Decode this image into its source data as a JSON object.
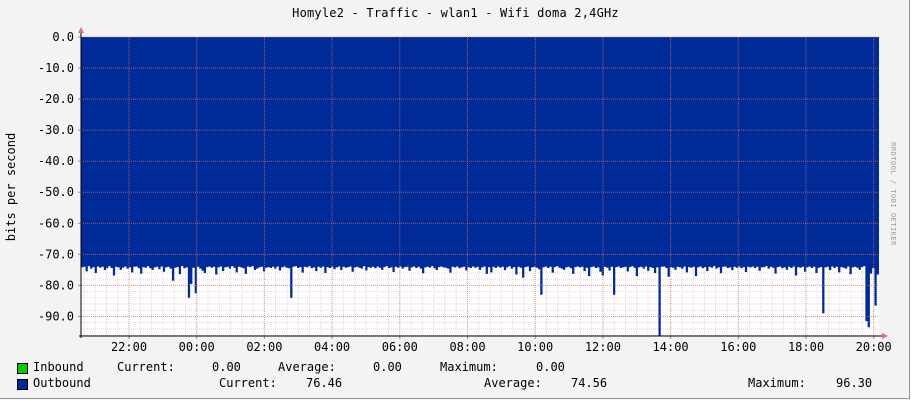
{
  "title": "Homyle2 - Traffic - wlan1 - Wifi doma 2,4GHz",
  "watermark": "RRDTOOL / TOBI OETIKER",
  "colors": {
    "background": "#F3F3F3",
    "plot_background": "#FFFFFF",
    "inbound": "#00CC00",
    "outbound": "#002A97",
    "grid": "#E0B0B0"
  },
  "legend": {
    "inbound": {
      "name": "Inbound",
      "current_label": "Current:",
      "current_value": "0.00",
      "average_label": "Average:",
      "average_value": "0.00",
      "maximum_label": "Maximum:",
      "maximum_value": "0.00"
    },
    "outbound": {
      "name": "Outbound",
      "current_label": "Current:",
      "current_value": "76.46",
      "average_label": "Average:",
      "average_value": "74.56",
      "maximum_label": "Maximum:",
      "maximum_value": "96.30"
    }
  },
  "chart_data": {
    "type": "area",
    "title": "Homyle2 - Traffic - wlan1 - Wifi doma 2,4GHz",
    "ylabel": "bits per second",
    "ylim": [
      -96.3,
      0
    ],
    "yticks": [
      "0.0",
      "-10.0",
      "-20.0",
      "-30.0",
      "-40.0",
      "-50.0",
      "-60.0",
      "-70.0",
      "-80.0",
      "-90.0"
    ],
    "ytick_values": [
      0,
      -10,
      -20,
      -30,
      -40,
      -50,
      -60,
      -70,
      -80,
      -90
    ],
    "xticks": [
      "22:00",
      "00:00",
      "02:00",
      "04:00",
      "06:00",
      "08:00",
      "10:00",
      "12:00",
      "14:00",
      "16:00",
      "18:00",
      "20:00"
    ],
    "grid": true,
    "series": [
      {
        "name": "Inbound",
        "values_summary": {
          "current": 0.0,
          "average": 0.0,
          "maximum": 0.0
        },
        "values": []
      },
      {
        "name": "Outbound",
        "values_summary": {
          "current": 76.46,
          "average": 74.56,
          "maximum": 96.3
        },
        "values": [
          -74.2,
          -74.0,
          -75.5,
          -73.8,
          -74.6,
          -74.1,
          -76.0,
          -73.9,
          -74.3,
          -74.0,
          -75.1,
          -74.5,
          -73.8,
          -74.4,
          -76.8,
          -74.0,
          -74.2,
          -75.0,
          -74.3,
          -73.9,
          -74.6,
          -74.2,
          -75.8,
          -74.0,
          -73.9,
          -74.5,
          -76.2,
          -74.1,
          -74.3,
          -73.8,
          -74.5,
          -75.0,
          -74.2,
          -74.0,
          -74.8,
          -73.9,
          -75.6,
          -74.2,
          -74.0,
          -74.6,
          -78.5,
          -74.3,
          -74.1,
          -76.4,
          -73.8,
          -74.5,
          -74.2,
          -84.0,
          -79.5,
          -74.3,
          -82.5,
          -74.0,
          -74.6,
          -75.3,
          -76.0,
          -74.1,
          -73.9,
          -74.3,
          -74.0,
          -76.5,
          -74.2,
          -73.9,
          -75.4,
          -74.2,
          -74.0,
          -74.6,
          -73.8,
          -74.3,
          -75.8,
          -74.0,
          -74.2,
          -74.5,
          -76.3,
          -73.9,
          -74.1,
          -73.8,
          -75.0,
          -74.6,
          -74.2,
          -74.0,
          -75.5,
          -74.3,
          -74.1,
          -74.4,
          -74.0,
          -74.6,
          -73.9,
          -75.2,
          -74.2,
          -73.9,
          -74.3,
          -74.5,
          -84.0,
          -74.0,
          -73.8,
          -74.4,
          -74.1,
          -75.9,
          -74.0,
          -74.2,
          -73.8,
          -74.5,
          -74.2,
          -75.4,
          -74.0,
          -74.3,
          -73.9,
          -76.0,
          -74.1,
          -74.4,
          -74.0,
          -74.8,
          -74.2,
          -73.9,
          -75.1,
          -74.0,
          -74.3,
          -74.1,
          -73.9,
          -75.6,
          -74.2,
          -74.0,
          -74.3,
          -74.6,
          -73.8,
          -75.2,
          -74.1,
          -74.3,
          -74.0,
          -74.5,
          -73.9,
          -74.3,
          -75.0,
          -74.1,
          -73.8,
          -74.4,
          -74.2,
          -75.7,
          -74.0,
          -74.3,
          -73.9,
          -74.6,
          -74.1,
          -74.0,
          -75.3,
          -74.2,
          -73.9,
          -74.4,
          -74.0,
          -74.6,
          -76.1,
          -74.2,
          -74.0,
          -74.3,
          -73.8,
          -74.5,
          -75.1,
          -74.1,
          -73.9,
          -74.2,
          -74.3,
          -74.6,
          -75.9,
          -74.0,
          -74.2,
          -73.9,
          -74.5,
          -74.2,
          -74.0,
          -75.2,
          -74.1,
          -74.4,
          -73.9,
          -74.3,
          -74.0,
          -75.0,
          -74.2,
          -73.9,
          -76.3,
          -74.1,
          -75.8,
          -74.0,
          -74.4,
          -73.9,
          -74.3,
          -74.0,
          -75.1,
          -74.2,
          -73.8,
          -74.6,
          -74.1,
          -76.5,
          -74.0,
          -74.3,
          -77.5,
          -74.1,
          -73.9,
          -75.4,
          -74.2,
          -74.0,
          -74.3,
          -74.8,
          -83.0,
          -74.2,
          -73.9,
          -74.4,
          -74.0,
          -75.9,
          -74.1,
          -73.8,
          -74.3,
          -74.6,
          -75.0,
          -74.2,
          -74.0,
          -74.5,
          -76.3,
          -74.1,
          -73.9,
          -74.2,
          -74.0,
          -75.4,
          -74.3,
          -77.0,
          -74.1,
          -73.9,
          -74.4,
          -74.2,
          -75.6,
          -76.8,
          -74.0,
          -74.3,
          -75.2,
          -74.0,
          -83.0,
          -74.1,
          -73.9,
          -74.4,
          -74.2,
          -74.0,
          -75.5,
          -74.1,
          -73.8,
          -74.3,
          -77.0,
          -74.2,
          -74.0,
          -74.6,
          -73.9,
          -75.3,
          -74.1,
          -74.4,
          -76.0,
          -74.2,
          -96.3,
          -74.0,
          -73.9,
          -74.4,
          -77.2,
          -74.1,
          -74.3,
          -75.0,
          -74.0,
          -74.2,
          -74.6,
          -73.9,
          -75.8,
          -74.1,
          -74.3,
          -74.0,
          -77.0,
          -74.2,
          -73.9,
          -74.5,
          -74.1,
          -75.4,
          -74.0,
          -74.3,
          -73.8,
          -74.6,
          -74.2,
          -76.1,
          -74.0,
          -73.9,
          -74.4,
          -74.2,
          -75.1,
          -74.0,
          -74.3,
          -73.9,
          -74.5,
          -74.1,
          -75.7,
          -74.0,
          -74.2,
          -73.9,
          -74.4,
          -74.0,
          -75.3,
          -74.2,
          -74.1,
          -73.8,
          -74.6,
          -74.0,
          -74.3,
          -76.2,
          -74.1,
          -73.9,
          -74.5,
          -74.2,
          -75.0,
          -74.0,
          -74.4,
          -73.9,
          -76.8,
          -74.1,
          -74.3,
          -74.0,
          -75.6,
          -74.2,
          -73.9,
          -74.4,
          -74.0,
          -76.0,
          -74.3,
          -74.1,
          -89.0,
          -74.2,
          -74.0,
          -75.1,
          -73.9,
          -74.4,
          -74.0,
          -75.8,
          -74.1,
          -74.3,
          -74.6,
          -73.9,
          -76.4,
          -74.2,
          -74.0,
          -74.3,
          -75.0,
          -74.1,
          -73.8,
          -91.5,
          -93.5,
          -76.2,
          -74.5,
          -86.5,
          -76.5
        ]
      }
    ]
  }
}
